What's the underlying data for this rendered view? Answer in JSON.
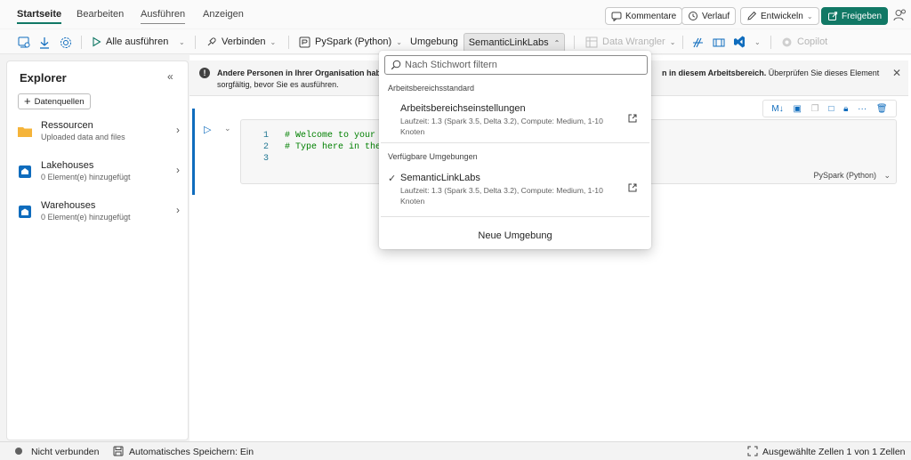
{
  "menu": {
    "tabs": [
      {
        "label": "Startseite"
      },
      {
        "label": "Bearbeiten"
      },
      {
        "label": "Ausführen"
      },
      {
        "label": "Anzeigen"
      }
    ],
    "actions": {
      "comments": "Kommentare",
      "history": "Verlauf",
      "develop": "Entwickeln",
      "share": "Freigeben"
    }
  },
  "toolbar": {
    "run_all": "Alle ausführen",
    "connect": "Verbinden",
    "language": "PySpark (Python)",
    "environment_label": "Umgebung",
    "environment_value": "SemanticLinkLabs",
    "data_wrangler": "Data Wrangler",
    "copilot": "Copilot"
  },
  "explorer": {
    "title": "Explorer",
    "add_datasource": "Datenquellen",
    "items": [
      {
        "name": "Ressourcen",
        "sub": "Uploaded data and files",
        "icon": "folder-icon"
      },
      {
        "name": "Lakehouses",
        "sub": "0 Element(e) hinzugefügt",
        "icon": "lakehouse-icon"
      },
      {
        "name": "Warehouses",
        "sub": "0 Element(e) hinzugefügt",
        "icon": "warehouse-icon"
      }
    ]
  },
  "warning": {
    "bold_start": "Andere Personen in Ihrer Organisation habe",
    "bold_end": "n in diesem Arbeitsbereich.",
    "normal_end": " Überprüfen Sie dieses Element",
    "line2": "sorgfältig, bevor Sie es ausführen."
  },
  "cell": {
    "lines": [
      {
        "num": "1",
        "code": "# Welcome to your n"
      },
      {
        "num": "2",
        "code": "# Type here in the"
      },
      {
        "num": "3",
        "code": ""
      }
    ],
    "language": "PySpark (Python)"
  },
  "dropdown": {
    "filter_placeholder": "Nach Stichwort filtern",
    "section_default": "Arbeitsbereichsstandard",
    "default_option": {
      "title": "Arbeitsbereichseinstellungen",
      "desc": "Laufzeit: 1.3 (Spark 3.5, Delta 3.2), Compute: Medium, 1-10 Knoten"
    },
    "section_available": "Verfügbare Umgebungen",
    "available_option": {
      "title": "SemanticLinkLabs",
      "desc": "Laufzeit: 1.3 (Spark 3.5, Delta 3.2), Compute: Medium, 1-10 Knoten",
      "selected": true
    },
    "new_environment": "Neue Umgebung"
  },
  "status": {
    "connection": "Nicht verbunden",
    "autosave": "Automatisches Speichern: Ein",
    "selection": "Ausgewählte Zellen 1 von 1 Zellen"
  },
  "colors": {
    "accent": "#117865",
    "link_blue": "#0f6cbd"
  }
}
